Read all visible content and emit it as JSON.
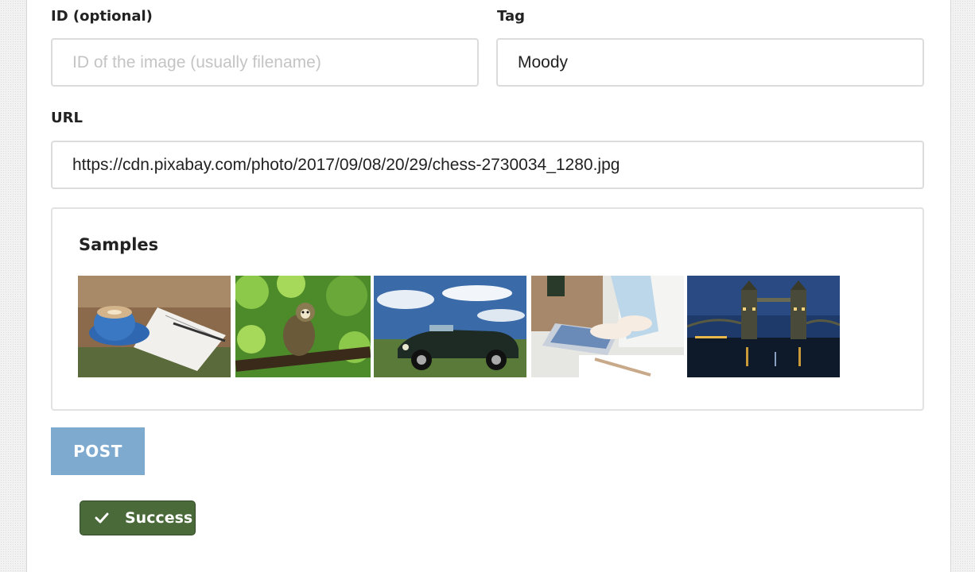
{
  "form": {
    "id_label": "ID (optional)",
    "id_value": "",
    "id_placeholder": "ID of the image (usually filename)",
    "tag_label": "Tag",
    "tag_value": "Moody",
    "url_label": "URL",
    "url_value": "https://cdn.pixabay.com/photo/2017/09/08/20/29/chess-2730034_1280.jpg"
  },
  "samples": {
    "title": "Samples",
    "images": [
      {
        "subject": "coffee cup and notebook"
      },
      {
        "subject": "monkey in tree"
      },
      {
        "subject": "vintage convertible car"
      },
      {
        "subject": "person typing on laptop"
      },
      {
        "subject": "tower bridge at night"
      }
    ]
  },
  "actions": {
    "post_label": "POST"
  },
  "status": {
    "success_label": "Success",
    "success_color": "#4a6a3a"
  },
  "colors": {
    "post_button": "#7eaad0",
    "field_border": "#dcdcdc"
  }
}
